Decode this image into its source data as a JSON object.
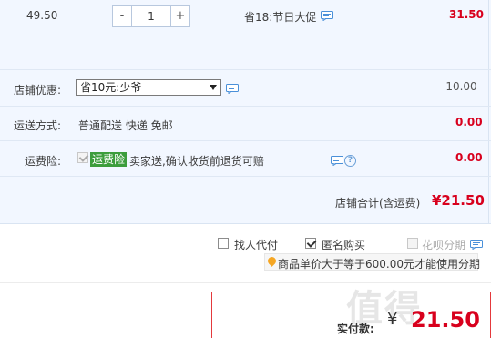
{
  "item": {
    "unit_price": "49.50",
    "quantity": "1",
    "minus_label": "-",
    "plus_label": "+",
    "promo": "省18:节日大促",
    "subtotal": "31.50"
  },
  "shop_discount": {
    "label": "店铺优惠:",
    "selected": "省10元:少爷",
    "amount": "-10.00"
  },
  "shipping": {
    "label": "运送方式:",
    "value": "普通配送 快递 免邮",
    "amount": "0.00"
  },
  "insurance": {
    "label": "运费险:",
    "tag": "运费险",
    "description": "卖家送,确认收货前退货可赔",
    "amount": "0.00"
  },
  "shop_total": {
    "label": "店铺合计(含运费)",
    "amount": "¥21.50"
  },
  "options": {
    "proxy_pay": "找人代付",
    "anonymous": "匿名购买",
    "installment": "花呗分期",
    "installment_tip": "商品单价大于等于600.00元才能使用分期"
  },
  "payment": {
    "label": "实付款:",
    "currency": "¥",
    "amount": "21.50"
  },
  "colors": {
    "accent_red": "#d8001d",
    "panel_blue": "#f2f7ff",
    "insurance_green": "#3c9d3c"
  }
}
